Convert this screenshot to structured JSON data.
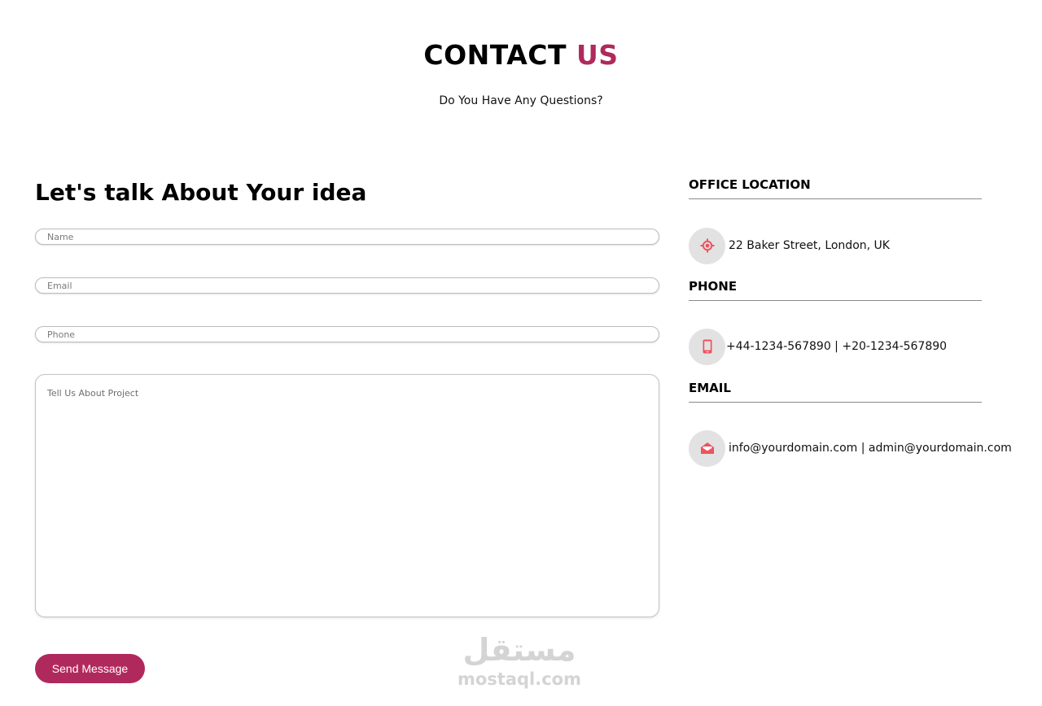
{
  "header": {
    "title_main": "CONTACT",
    "title_accent": "US",
    "subtitle": "Do You Have Any Questions?"
  },
  "form": {
    "heading": "Let's talk About Your idea",
    "name_placeholder": "Name",
    "email_placeholder": "Email",
    "phone_placeholder": "Phone",
    "message_placeholder": "Tell Us About Project",
    "submit_label": "Send Message"
  },
  "contact_info": {
    "office": {
      "heading": "OFFICE LOCATION",
      "icon": "location-target-icon",
      "text": "22 Baker Street, London, UK"
    },
    "phone": {
      "heading": "PHONE",
      "icon": "mobile-phone-icon",
      "text": "+44-1234-567890 | +20-1234-567890"
    },
    "email": {
      "heading": "EMAIL",
      "icon": "open-envelope-icon",
      "text": "info@yourdomain.com | admin@yourdomain.com"
    }
  },
  "watermark": {
    "arabic": "مستقل",
    "latin": "mostaql.com"
  },
  "colors": {
    "accent": "#b0295c",
    "icon": "#f0525f",
    "icon_bg": "#e2e2e2"
  }
}
